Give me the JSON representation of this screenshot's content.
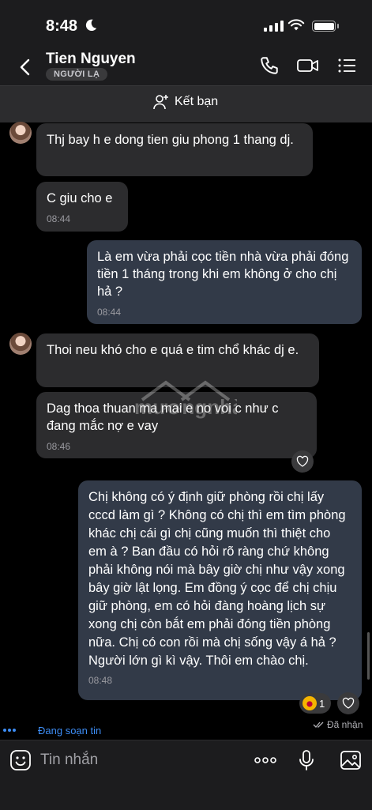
{
  "status_bar": {
    "time": "8:48"
  },
  "header": {
    "contact_name": "Tien Nguyen",
    "badge": "NGƯỜI LẠ"
  },
  "add_friend": {
    "label": "Kết bạn"
  },
  "messages": [
    {
      "side": "in",
      "text": "Thj bay h e dong tien giu phong 1 thang dj.",
      "time": ""
    },
    {
      "side": "in",
      "text": "C giu cho e",
      "time": "08:44"
    },
    {
      "side": "out",
      "text": "Là em vừa phải cọc tiền nhà vừa phải đóng tiền 1 tháng trong khi em không ở cho chị hả ?",
      "time": "08:44"
    },
    {
      "side": "in",
      "text": "Thoi neu khó cho e quá e tim chổ khác dj e.",
      "time": ""
    },
    {
      "side": "in",
      "text": "Dag thoa thuan ma mai e no voi c như c đang mắc nợ e vay",
      "time": "08:46"
    },
    {
      "side": "out",
      "text": "Chị không có ý định giữ phòng rồi chị lấy cccd làm gì ? Không có chị thì em tìm phòng khác chị cái gì chị cũng muốn thì thiệt cho em à ? Ban đầu có hỏi rõ ràng chứ không phải không nói mà bây giờ chị như vậy xong bây giờ lật lọng. Em đồng ý cọc để chị chịu giữ phòng, em có hỏi đàng hoàng lịch sự xong chị còn bắt em phải đóng tiền phòng nữa. Chị có con rồi mà chị sống vậy á hả ? Người lớn gì kì vậy. Thôi em chào chị.",
      "time": "08:48"
    }
  ],
  "reaction": {
    "count": "1"
  },
  "seen_status": "Đã nhận",
  "typing_status": "Đang soạn tin",
  "composer": {
    "placeholder": "Tin nhắn"
  },
  "watermark": {
    "text": "mươngnhà"
  }
}
